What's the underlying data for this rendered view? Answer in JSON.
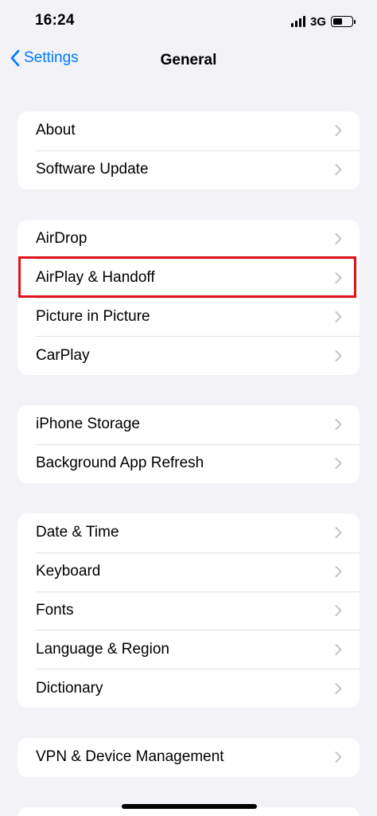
{
  "status_bar": {
    "time": "16:24",
    "network": "3G",
    "battery_level": 0.5
  },
  "nav": {
    "back_label": "Settings",
    "title": "General"
  },
  "groups": [
    {
      "items": [
        {
          "label": "About"
        },
        {
          "label": "Software Update"
        }
      ]
    },
    {
      "items": [
        {
          "label": "AirDrop"
        },
        {
          "label": "AirPlay & Handoff"
        },
        {
          "label": "Picture in Picture"
        },
        {
          "label": "CarPlay"
        }
      ]
    },
    {
      "items": [
        {
          "label": "iPhone Storage"
        },
        {
          "label": "Background App Refresh"
        }
      ]
    },
    {
      "items": [
        {
          "label": "Date & Time"
        },
        {
          "label": "Keyboard"
        },
        {
          "label": "Fonts"
        },
        {
          "label": "Language & Region"
        },
        {
          "label": "Dictionary"
        }
      ]
    },
    {
      "items": [
        {
          "label": "VPN & Device Management"
        }
      ]
    }
  ],
  "highlighted_item": "AirPlay & Handoff",
  "colors": {
    "accent": "#007aff",
    "highlight": "#e01119",
    "background": "#f2f2f7",
    "chevron": "#c4c4c7"
  }
}
